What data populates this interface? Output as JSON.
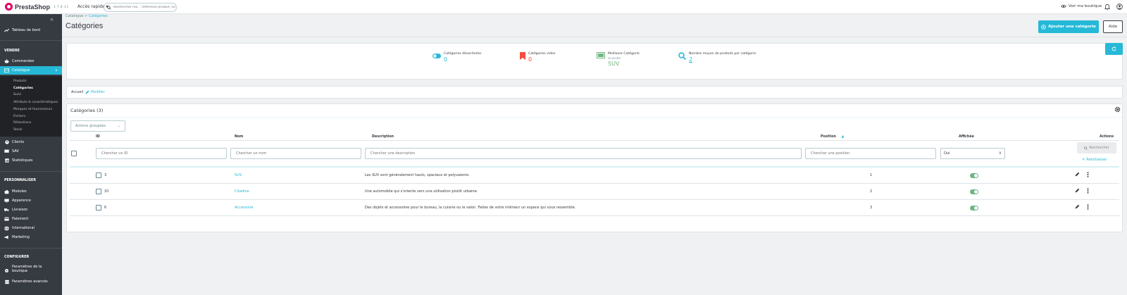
{
  "header": {
    "brand": "PrestaShop",
    "version": "1.7.8.11",
    "quick_access": "Accès rapide",
    "search_placeholder": "Rechercher (ex. : référence produit, no",
    "view_shop": "Voir ma boutique"
  },
  "sidebar": {
    "dashboard": "Tableau de bord",
    "sections": {
      "sell": "VENDRE",
      "customize": "PERSONNALISER",
      "configure": "CONFIGURER"
    },
    "sell_items": {
      "orders": "Commandes",
      "catalog": "Catalogue",
      "customers": "Clients",
      "sav": "SAV",
      "stats": "Statistiques"
    },
    "catalog_sub": [
      "Produits",
      "Catégories",
      "Suivi",
      "Attributs & caractéristiques",
      "Marques et fournisseurs",
      "Fichiers",
      "Réductions",
      "Stock"
    ],
    "customize_items": [
      "Modules",
      "Apparence",
      "Livraison",
      "Paiement",
      "International",
      "Marketing"
    ],
    "configure_items": {
      "shop_params_1": "Paramètres de la",
      "shop_params_2": "boutique",
      "advanced_params": "Paramètres avancés"
    }
  },
  "page": {
    "breadcrumb_parent": "Catalogue",
    "breadcrumb_current": "Catégories",
    "title": "Catégories",
    "add_button": "Ajouter une catégorie",
    "help_button": "Aide"
  },
  "kpis": {
    "disabled": {
      "label": "Catégories désactivées",
      "value": "0"
    },
    "empty": {
      "label": "Catégories vides",
      "value": "0"
    },
    "best": {
      "label": "Meilleure Catégorie",
      "sub": "30 JOURS",
      "value": "SUV"
    },
    "avg": {
      "label": "Nombre moyen de produits par catégorie",
      "value": "2"
    }
  },
  "crumb": {
    "home": "Accueil",
    "edit": "Modifier"
  },
  "table": {
    "title": "Catégories (3)",
    "bulk_actions": "Actions groupées",
    "columns": {
      "id": "ID",
      "name": "Nom",
      "description": "Description",
      "position": "Position",
      "displayed": "Affichée",
      "actions": "Actions"
    },
    "filters": {
      "id": "Chercher un ID",
      "name": "Chercher un nom",
      "description": "Chercher une description",
      "position": "Chercher une position",
      "displayed": "Oui"
    },
    "search_button": "Rechercher",
    "reset_button": "Réinitialiser",
    "rows": [
      {
        "id": "3",
        "name": "SUV",
        "description": "Les SUV sont généralement hauts, spacieux et polyvalents.",
        "position": "1"
      },
      {
        "id": "10",
        "name": "Citadine",
        "description": "Une automobile qui s'oriente vers une utilisation plutôt urbaine.",
        "position": "2"
      },
      {
        "id": "6",
        "name": "Accessoire",
        "description": "Des objets et accessoires pour le bureau, la cuisine ou le salon. Faites de votre intérieur un espace qui vous ressemble.",
        "position": "3"
      }
    ]
  },
  "colors": {
    "accent": "#25b9d7",
    "sidebar": "#363a41",
    "danger": "#f54c3e",
    "success": "#70b580"
  }
}
